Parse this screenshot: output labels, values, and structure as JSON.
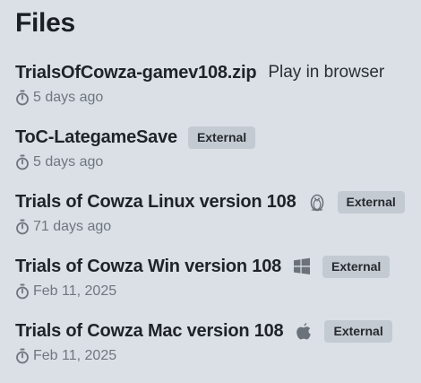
{
  "heading": "Files",
  "files": [
    {
      "name": "TrialsOfCowza-gamev108.zip",
      "action": "Play in browser",
      "date": "5 days ago"
    },
    {
      "name": "ToC-LategameSave",
      "badge": "External",
      "date": "5 days ago"
    },
    {
      "name": "Trials of Cowza Linux version 108",
      "platform_icon": "linux-icon",
      "badge": "External",
      "date": "71 days ago"
    },
    {
      "name": "Trials of Cowza Win version 108",
      "platform_icon": "windows-icon",
      "badge": "External",
      "date": "Feb 11, 2025"
    },
    {
      "name": "Trials of Cowza Mac version 108",
      "platform_icon": "apple-icon",
      "badge": "External",
      "date": "Feb 11, 2025"
    }
  ],
  "colors": {
    "background": "#dae0e6",
    "badge_bg": "#c4cad1",
    "meta_text": "#70767d"
  }
}
